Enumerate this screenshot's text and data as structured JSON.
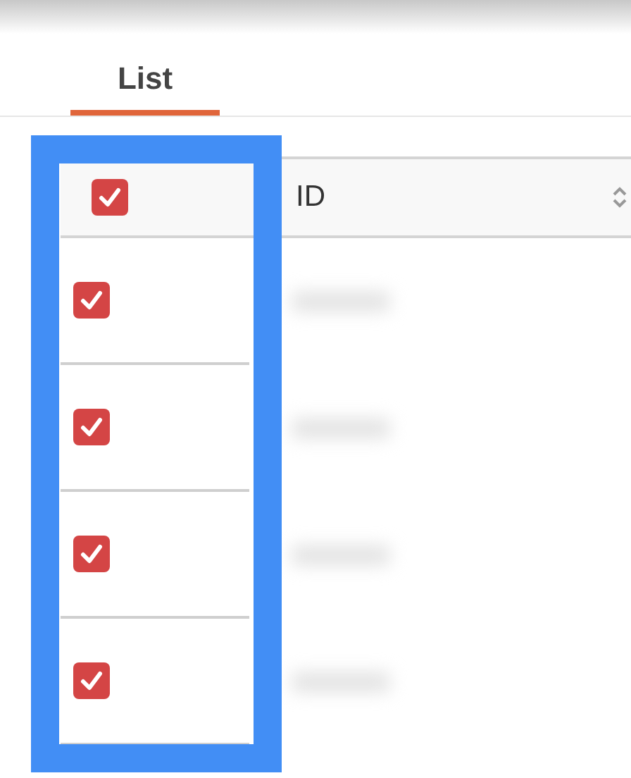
{
  "tabs": [
    {
      "label": "List",
      "selected": true
    }
  ],
  "table": {
    "select_all": {
      "checked": true
    },
    "columns": [
      {
        "label": "ID",
        "sortable": true
      }
    ],
    "rows": [
      {
        "checked": true
      },
      {
        "checked": true
      },
      {
        "checked": true
      },
      {
        "checked": true
      }
    ]
  },
  "highlight": {
    "on": true
  }
}
